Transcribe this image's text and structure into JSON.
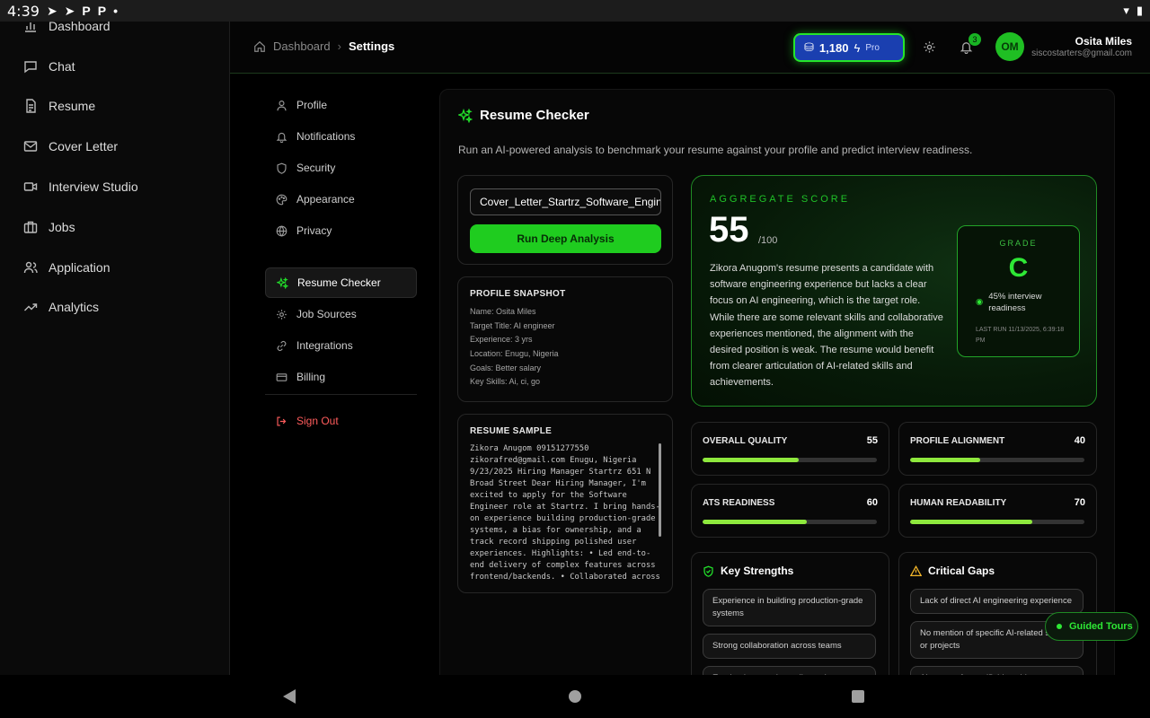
{
  "status_bar": {
    "time": "4:39",
    "icons": [
      "P",
      "P"
    ]
  },
  "sidebar": {
    "items": [
      {
        "label": "Dashboard",
        "icon": "bar-chart-icon"
      },
      {
        "label": "Chat",
        "icon": "chat-icon"
      },
      {
        "label": "Resume",
        "icon": "document-icon"
      },
      {
        "label": "Cover Letter",
        "icon": "mail-icon"
      },
      {
        "label": "Interview Studio",
        "icon": "video-icon"
      },
      {
        "label": "Jobs",
        "icon": "briefcase-icon"
      },
      {
        "label": "Application",
        "icon": "users-icon"
      },
      {
        "label": "Analytics",
        "icon": "trend-icon"
      }
    ]
  },
  "header": {
    "breadcrumb_root": "Dashboard",
    "breadcrumb_current": "Settings",
    "credits": "1,180",
    "plan": "Pro",
    "notifications": "3",
    "avatar_initials": "OM",
    "user_name": "Osita Miles",
    "user_email": "siscostarters@gmail.com"
  },
  "settings_nav": {
    "items": [
      {
        "label": "Profile"
      },
      {
        "label": "Notifications"
      },
      {
        "label": "Security"
      },
      {
        "label": "Appearance"
      },
      {
        "label": "Privacy"
      },
      {
        "label": "Resume Checker"
      },
      {
        "label": "Job Sources"
      },
      {
        "label": "Integrations"
      },
      {
        "label": "Billing"
      }
    ],
    "sign_out": "Sign Out"
  },
  "checker": {
    "title": "Resume Checker",
    "description": "Run an AI-powered analysis to benchmark your resume against your profile and predict interview readiness.",
    "file_name": "Cover_Letter_Startrz_Software_Engineer",
    "run_button": "Run Deep Analysis"
  },
  "profile_snapshot": {
    "heading": "PROFILE SNAPSHOT",
    "lines": [
      "Name: Osita Miles",
      "Target Title: AI engineer",
      "Experience: 3 yrs",
      "Location: Enugu, Nigeria",
      "Goals: Better salary",
      "Key Skills: Ai, ci, go"
    ]
  },
  "resume_sample": {
    "heading": "RESUME SAMPLE",
    "text": "Zikora Anugom 09151277550 zikorafred@gmail.com Enugu, Nigeria 9/23/2025 Hiring Manager Startrz 651 N Broad Street Dear Hiring Manager, I'm excited to apply for the Software Engineer role at Startrz. I bring hands-on experience building production-grade systems, a bias for ownership, and a track record shipping polished user experiences. Highlights: • Led end-to-end delivery of complex features across frontend/backends. • Collaborated across"
  },
  "aggregate": {
    "label": "AGGREGATE SCORE",
    "score": "55",
    "denominator": "/100",
    "summary": "Zikora Anugom's resume presents a candidate with software engineering experience but lacks a clear focus on AI engineering, which is the target role. While there are some relevant skills and collaborative experiences mentioned, the alignment with the desired position is weak. The resume would benefit from clearer articulation of AI-related skills and achievements.",
    "grade_label": "GRADE",
    "grade": "C",
    "readiness": "45% interview readiness",
    "last_run": "LAST RUN 11/13/2025, 6:39:18 PM"
  },
  "metrics": [
    {
      "label": "OVERALL QUALITY",
      "value": "55",
      "fraction": 0.55
    },
    {
      "label": "PROFILE ALIGNMENT",
      "value": "40",
      "fraction": 0.4
    },
    {
      "label": "ATS READINESS",
      "value": "60",
      "fraction": 0.6
    },
    {
      "label": "HUMAN READABILITY",
      "value": "70",
      "fraction": 0.7
    }
  ],
  "strengths": {
    "title": "Key Strengths",
    "items": [
      "Experience in building production-grade systems",
      "Strong collaboration across teams",
      "Emphasis on code quality and"
    ]
  },
  "gaps": {
    "title": "Critical Gaps",
    "items": [
      "Lack of direct AI engineering experience",
      "No mention of specific AI-related skills or projects",
      "Absence of quantifiable achievements"
    ]
  },
  "guided_tours": "Guided Tours",
  "colors": {
    "accent": "#1fcc1f",
    "bar_fill": "#8ee83d",
    "credits_bg": "#1a3fb0",
    "danger": "#ff5c5c"
  }
}
